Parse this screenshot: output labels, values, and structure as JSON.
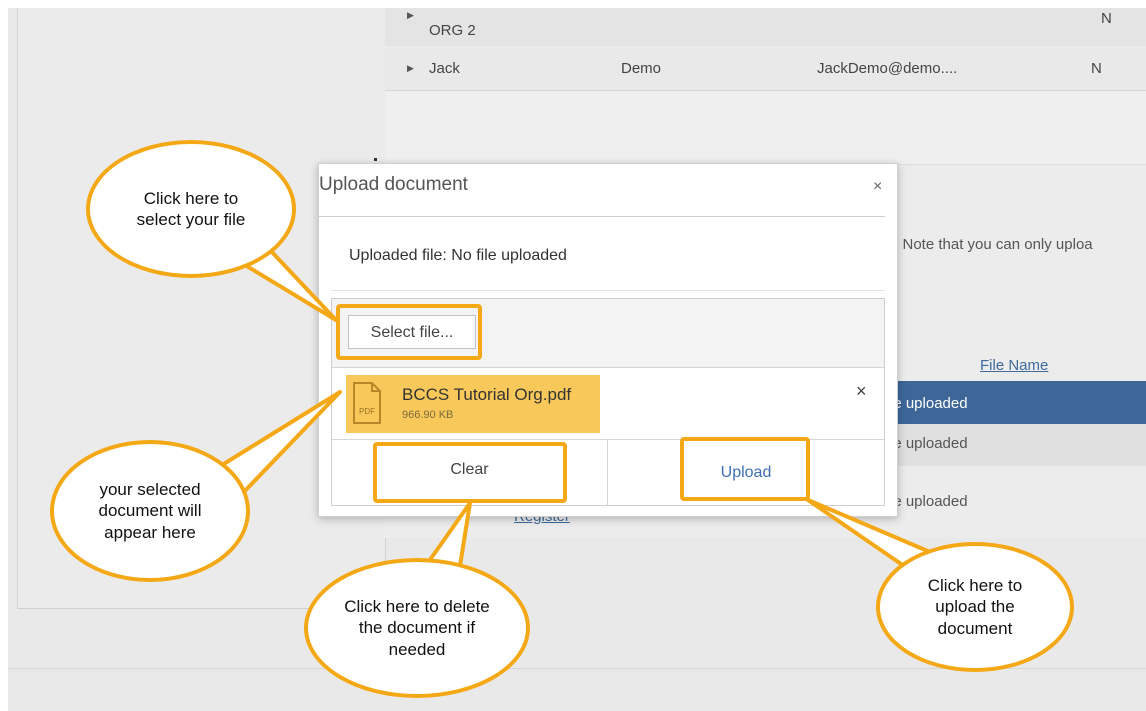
{
  "background": {
    "rows": [
      {
        "first": "ORG 2",
        "last": "",
        "email": "",
        "flag": "N"
      },
      {
        "first": "Jack",
        "last": "Demo",
        "email": "JackDemo@demo....",
        "flag": "N"
      }
    ],
    "note": "t. Note that you can only uploa",
    "file_name_header": "File Name",
    "uploaded_rows": [
      "le uploaded",
      "le uploaded",
      "le uploaded"
    ],
    "register_link": "Register"
  },
  "modal": {
    "title": "Upload document",
    "close": "×",
    "uploaded_file_label": "Uploaded file: No file uploaded",
    "select_button": "Select file...",
    "file": {
      "name": "BCCS Tutorial Org.pdf",
      "size": "966.90 KB",
      "icon_label": "PDF",
      "remove": "×"
    },
    "clear_button": "Clear",
    "upload_button": "Upload"
  },
  "callouts": {
    "select": "Click here to select your file",
    "selected_doc": "your selected document will appear here",
    "clear": "Click here to delete the document if needed",
    "upload": "Click here to upload the document"
  },
  "colors": {
    "highlight": "#f5a816",
    "file_item": "#f8c95a",
    "selected_row": "#3e6799",
    "link": "#3f6fb3"
  }
}
